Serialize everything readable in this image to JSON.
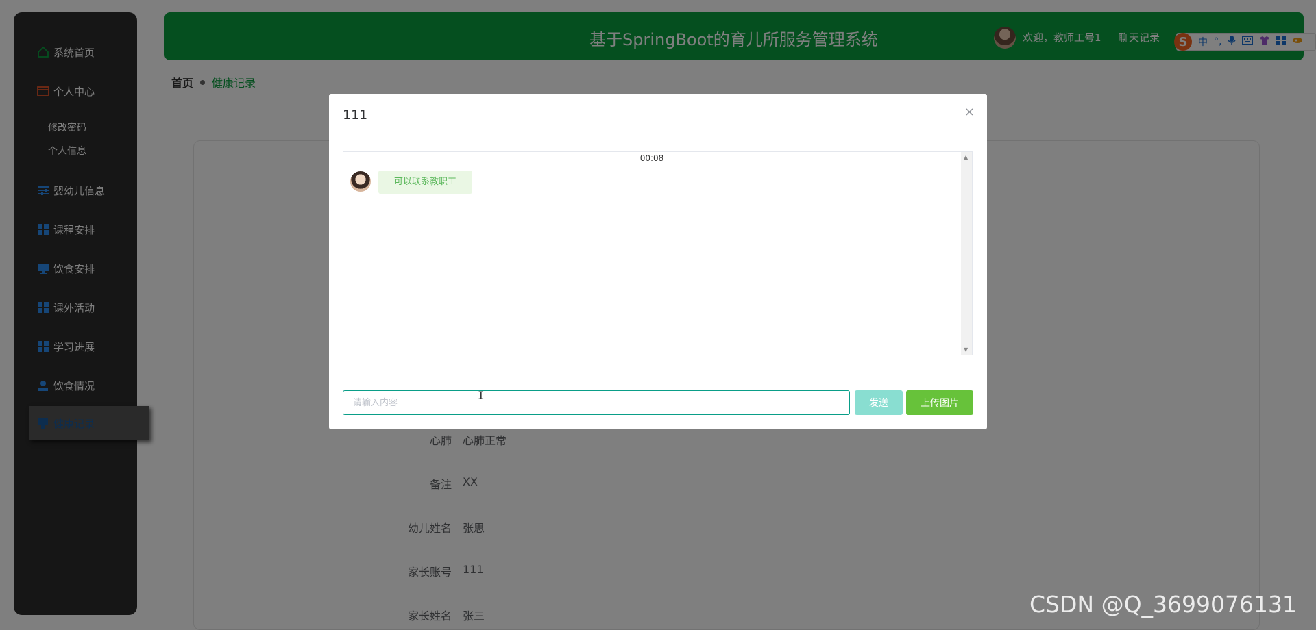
{
  "sidebar": {
    "items": [
      {
        "label": "系统首页",
        "icon": "home-icon"
      },
      {
        "label": "个人中心",
        "icon": "card-icon"
      },
      {
        "label": "婴幼儿信息",
        "icon": "sliders-icon"
      },
      {
        "label": "课程安排",
        "icon": "grid-icon"
      },
      {
        "label": "饮食安排",
        "icon": "monitor-icon"
      },
      {
        "label": "课外活动",
        "icon": "grid-icon"
      },
      {
        "label": "学习进展",
        "icon": "grid-icon"
      },
      {
        "label": "饮食情况",
        "icon": "user-icon"
      },
      {
        "label": "健康记录",
        "icon": "stamp-icon"
      }
    ],
    "sub_items": [
      "修改密码",
      "个人信息"
    ]
  },
  "header": {
    "title": "基于SpringBoot的育儿所服务管理系统",
    "welcome": "欢迎，教师工号1",
    "chat_link": "聊天记录"
  },
  "ime": {
    "mode": "中",
    "punct": "°,"
  },
  "breadcrumb": {
    "home": "首页",
    "current": "健康记录"
  },
  "form": {
    "rows": [
      {
        "label": "心肺",
        "value": "心肺正常"
      },
      {
        "label": "备注",
        "value": "XX"
      },
      {
        "label": "幼儿姓名",
        "value": "张思"
      },
      {
        "label": "家长账号",
        "value": "111"
      },
      {
        "label": "家长姓名",
        "value": "张三"
      }
    ]
  },
  "dialog": {
    "title": "111",
    "close": "×",
    "message": {
      "time": "00:08",
      "text": "可以联系教职工"
    },
    "input_placeholder": "请输入内容",
    "send_label": "发送",
    "upload_label": "上传图片"
  },
  "watermark": "CSDN @Q_3699076131",
  "colors": {
    "header": "#0a9e3e",
    "sidebar": "#2c2c2c",
    "send": "#89ded1",
    "upload": "#67c23a"
  }
}
